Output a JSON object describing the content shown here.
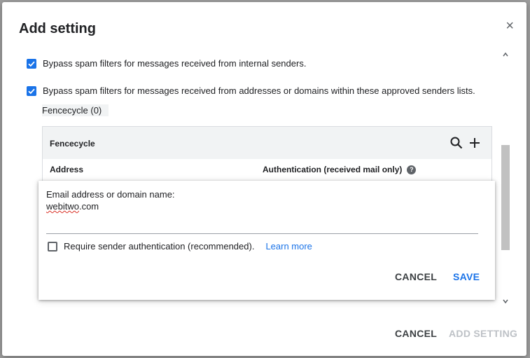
{
  "dialog": {
    "title": "Add setting",
    "close_glyph": "×"
  },
  "options": {
    "internal_label": "Bypass spam filters for messages received from internal senders.",
    "internal_checked": true,
    "approved_label": "Bypass spam filters for messages received from addresses or domains within these approved senders lists.",
    "approved_checked": true,
    "list_chip": "Fencecycle (0)"
  },
  "table": {
    "name": "Fencecycle",
    "col_address": "Address",
    "col_auth": "Authentication (received mail only)",
    "help_glyph": "?",
    "icons": [
      "search-icon",
      "add-icon"
    ]
  },
  "popup": {
    "field_label": "Email address or domain name:",
    "field_value_misspelled": "webitwo",
    "field_value_rest": ".com",
    "require_label": "Require sender authentication (recommended).",
    "require_checked": false,
    "learn_more": "Learn more",
    "cancel": "CANCEL",
    "save": "SAVE"
  },
  "footer": {
    "cancel": "CANCEL",
    "add_setting": "ADD SETTING"
  },
  "colors": {
    "accent": "#1a73e8",
    "disabled_text": "#bdc1c6",
    "header_bg": "#f1f3f4"
  }
}
